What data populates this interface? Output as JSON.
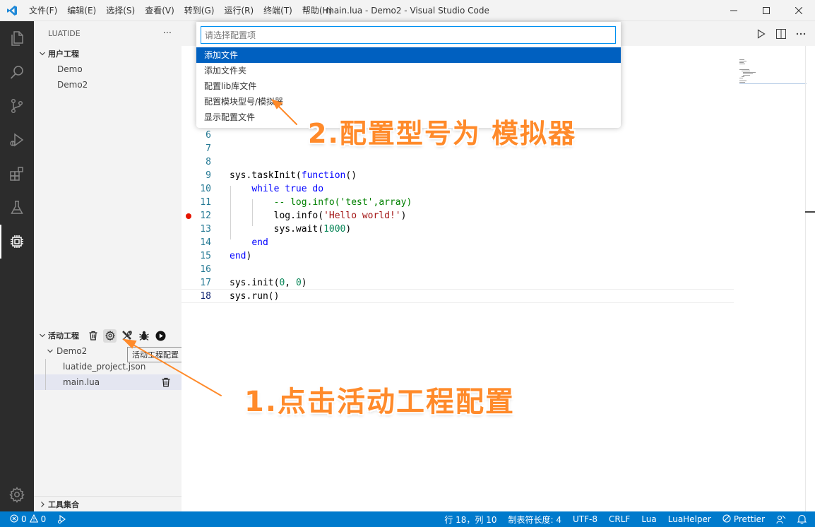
{
  "window": {
    "title": "main.lua - Demo2 - Visual Studio Code",
    "menu": [
      "文件(F)",
      "编辑(E)",
      "选择(S)",
      "查看(V)",
      "转到(G)",
      "运行(R)",
      "终端(T)",
      "帮助(H)"
    ],
    "controls": [
      "—",
      "☐",
      "✕"
    ]
  },
  "activitybar": {
    "icons": [
      "files-icon",
      "search-icon",
      "source-control-icon",
      "run-debug-icon",
      "extensions-icon",
      "testing-icon",
      "luatide-chip-icon"
    ],
    "active": "luatide-chip-icon",
    "bottom_icon": "settings-gear-icon"
  },
  "sidebar": {
    "header": "LUATIDE",
    "more": "···",
    "user_projects": {
      "title": "用户工程",
      "items": [
        "Demo",
        "Demo2"
      ]
    },
    "active_project": {
      "title": "活动工程",
      "tools": [
        "trash-icon",
        "gear-icon",
        "tools-icon",
        "bug-icon",
        "play-circle-icon"
      ],
      "project": "Demo2",
      "files": [
        "luatide_project.json",
        "main.lua"
      ],
      "selected_file": "main.lua"
    },
    "tooltip": "活动工程配置",
    "bottom_section": "工具集合"
  },
  "editor": {
    "toolbar": [
      "run-icon",
      "split-editor-icon",
      "more-icon"
    ],
    "line_numbers": [
      "6",
      "7",
      "8",
      "9",
      "10",
      "11",
      "12",
      "13",
      "14",
      "15",
      "16",
      "17",
      "18"
    ],
    "current_line": "18",
    "breakpoint_line": "12"
  },
  "quickpick": {
    "placeholder": "请选择配置项",
    "items": [
      "添加文件",
      "添加文件夹",
      "配置lib库文件",
      "配置模块型号/模拟器",
      "显示配置文件"
    ],
    "selected": "添加文件"
  },
  "annotations": {
    "step1": "1.点击活动工程配置",
    "step2": "2.配置型号为 模拟器",
    "color": "#ff8a2a"
  },
  "statusbar": {
    "errors": "0",
    "warnings": "0",
    "position": "行 18，列 10",
    "tab_size": "制表符长度: 4",
    "encoding": "UTF-8",
    "eol": "CRLF",
    "language": "Lua",
    "helper": "LuaHelper",
    "prettier": "Prettier",
    "color": "#007acc"
  }
}
